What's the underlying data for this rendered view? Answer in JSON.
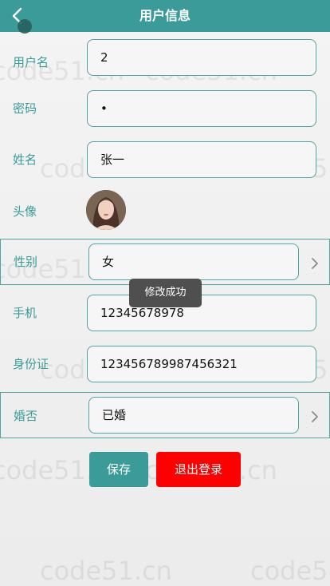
{
  "header": {
    "title": "用户信息"
  },
  "fields": [
    {
      "label": "用户名",
      "value": "2"
    },
    {
      "label": "密码",
      "value": "•"
    },
    {
      "label": "姓名",
      "value": "张一"
    },
    {
      "label": "头像"
    },
    {
      "label": "性别",
      "value": "女"
    },
    {
      "label": "手机",
      "value": "12345678978"
    },
    {
      "label": "身份证",
      "value": "123456789987456321"
    },
    {
      "label": "婚否",
      "value": "已婚"
    }
  ],
  "toast": "修改成功",
  "buttons": {
    "save": "保存",
    "logout": "退出登录"
  },
  "watermark": "code51.cn",
  "colors": {
    "primary": "#3a9b98",
    "danger": "#ff0000",
    "toast": "#4f4f4f"
  }
}
